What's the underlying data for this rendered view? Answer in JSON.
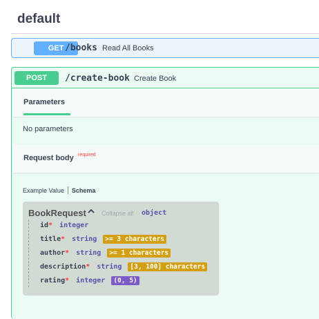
{
  "section": {
    "title": "default"
  },
  "operations": [
    {
      "method": "GET",
      "path": "/books",
      "summary": "Read All Books"
    },
    {
      "method": "POST",
      "path": "/create-book",
      "summary": "Create Book"
    }
  ],
  "parameters": {
    "tab_label": "Parameters",
    "empty_text": "No parameters"
  },
  "request_body": {
    "label": "Request body",
    "required_label": "required"
  },
  "model_tabs": {
    "example": "Example Value",
    "schema": "Schema"
  },
  "model": {
    "name": "BookRequest",
    "collapse_label": "Collapse all",
    "type": "object",
    "properties": [
      {
        "name": "id",
        "required": "*",
        "type": "integer",
        "constraint": ""
      },
      {
        "name": "title",
        "required": "*",
        "type": "string",
        "constraint": ">= 3 characters"
      },
      {
        "name": "author",
        "required": "*",
        "type": "string",
        "constraint": ">= 1 characters"
      },
      {
        "name": "description",
        "required": "*",
        "type": "string",
        "constraint": "[3, 100] characters"
      },
      {
        "name": "rating",
        "required": "*",
        "type": "integer",
        "constraint": "(0, 5)"
      }
    ]
  },
  "colors": {
    "get": "#61affe",
    "post": "#49cc90",
    "constraint_badge": "#d4a013",
    "range_badge": "#7d5bc6"
  },
  "icons": {
    "model_toggle": "chevron-up-icon"
  }
}
